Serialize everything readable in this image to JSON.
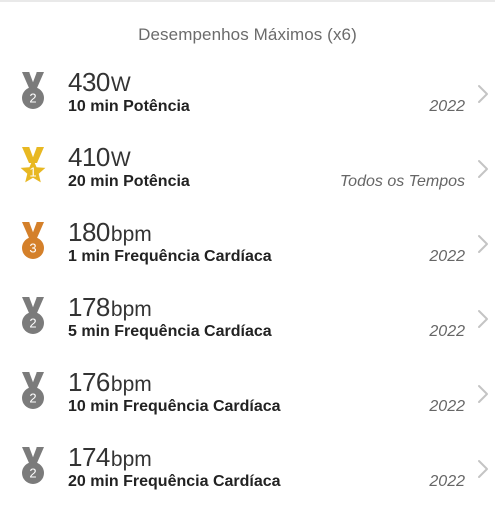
{
  "header": {
    "title": "Desempenhos Máximos (x6)"
  },
  "colors": {
    "silver": "#7b7b7b",
    "gold": "#e8b822",
    "bronze": "#d4802a",
    "chevron": "#c4c4c4"
  },
  "records": [
    {
      "value": "430",
      "unit": "W",
      "label": "10 min Potência",
      "period": "2022",
      "medal": "silver",
      "rank": "2"
    },
    {
      "value": "410",
      "unit": "W",
      "label": "20 min Potência",
      "period": "Todos os Tempos",
      "medal": "gold",
      "rank": "1"
    },
    {
      "value": "180",
      "unit": "bpm",
      "label": "1 min Frequência Cardíaca",
      "period": "2022",
      "medal": "bronze",
      "rank": "3"
    },
    {
      "value": "178",
      "unit": "bpm",
      "label": "5 min Frequência Cardíaca",
      "period": "2022",
      "medal": "silver",
      "rank": "2"
    },
    {
      "value": "176",
      "unit": "bpm",
      "label": "10 min Frequência Cardíaca",
      "period": "2022",
      "medal": "silver",
      "rank": "2"
    },
    {
      "value": "174",
      "unit": "bpm",
      "label": "20 min Frequência Cardíaca",
      "period": "2022",
      "medal": "silver",
      "rank": "2"
    }
  ]
}
